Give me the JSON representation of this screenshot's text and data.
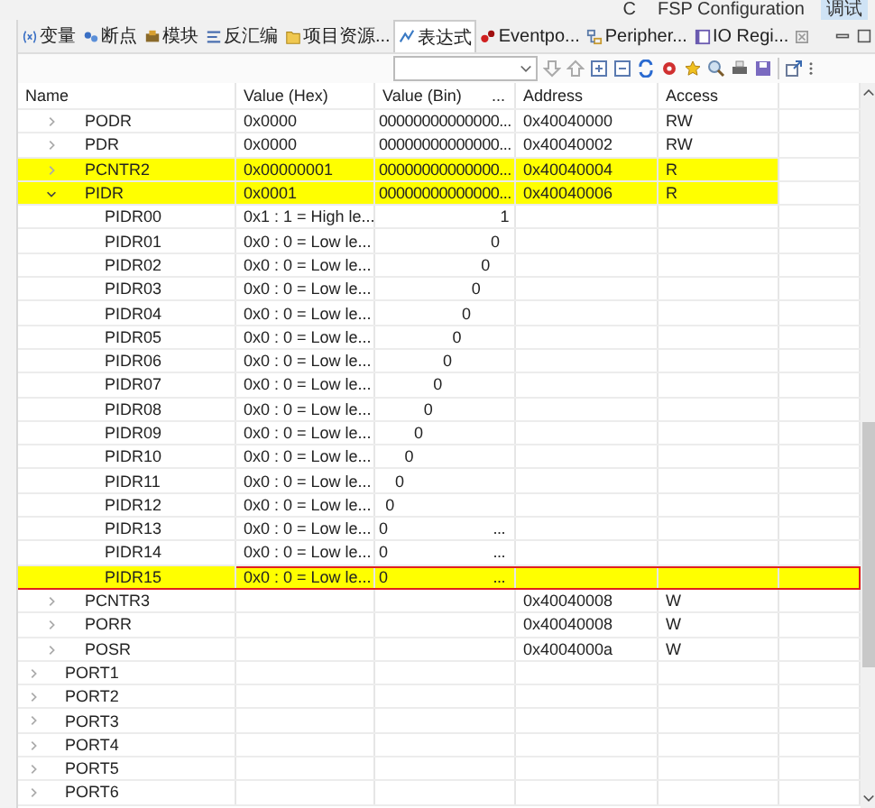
{
  "perspectives": [
    {
      "label": "C",
      "selected": false
    },
    {
      "label": "FSP Configuration",
      "selected": false
    },
    {
      "label": "调试",
      "selected": true
    }
  ],
  "tabs": [
    {
      "label": "变量",
      "kind": "variable",
      "selected": false,
      "closable": false
    },
    {
      "label": "断点",
      "kind": "breakpoint",
      "selected": false,
      "closable": false
    },
    {
      "label": "模块",
      "kind": "module",
      "selected": false,
      "closable": false
    },
    {
      "label": "反汇编",
      "kind": "disassembly",
      "selected": false,
      "closable": false
    },
    {
      "label": "项目资源...",
      "kind": "folder",
      "selected": false,
      "closable": false
    },
    {
      "label": "表达式",
      "kind": "expression",
      "selected": true,
      "closable": false
    },
    {
      "label": "Eventpo...",
      "kind": "eventpoint",
      "selected": false,
      "closable": false
    },
    {
      "label": "Peripher...",
      "kind": "peripheral",
      "selected": false,
      "closable": false
    },
    {
      "label": "IO Regi...",
      "kind": "ioreg",
      "selected": false,
      "closable": true
    }
  ],
  "table": {
    "columns": [
      {
        "label": "Name"
      },
      {
        "label": "Value (Hex)"
      },
      {
        "label": "Value (Bin)",
        "more": "..."
      },
      {
        "label": "Address"
      },
      {
        "label": "Access"
      }
    ],
    "rows": [
      {
        "children": [
          {
            "name": "PODR",
            "hex": "0x0000",
            "bin": "00000000000000...",
            "address": "0x40040000",
            "access": "RW",
            "expanded": false,
            "highlighted": false,
            "selected": false
          },
          {
            "name": "PDR",
            "hex": "0x0000",
            "bin": "00000000000000...",
            "address": "0x40040002",
            "access": "RW",
            "expanded": false,
            "highlighted": false,
            "selected": false
          },
          {
            "name": "PCNTR2",
            "hex": "0x00000001",
            "bin": "00000000000000...",
            "address": "0x40040004",
            "access": "R",
            "expanded": false,
            "highlighted": true,
            "selected": false
          },
          {
            "name": "PIDR",
            "hex": "0x0001",
            "bin": "00000000000000...",
            "address": "0x40040006",
            "access": "R",
            "expanded": true,
            "highlighted": true,
            "selected": false,
            "children": [
              {
                "name": "PIDR00",
                "hex": "0x1 : 1 = High le...",
                "bin": "1",
                "highlighted": false,
                "selected": false
              },
              {
                "name": "PIDR01",
                "hex": "0x0 : 0 = Low le...",
                "bin": "0",
                "highlighted": false,
                "selected": false
              },
              {
                "name": "PIDR02",
                "hex": "0x0 : 0 = Low le...",
                "bin": "0",
                "highlighted": false,
                "selected": false
              },
              {
                "name": "PIDR03",
                "hex": "0x0 : 0 = Low le...",
                "bin": "0",
                "highlighted": false,
                "selected": false
              },
              {
                "name": "PIDR04",
                "hex": "0x0 : 0 = Low le...",
                "bin": "0",
                "highlighted": false,
                "selected": false
              },
              {
                "name": "PIDR05",
                "hex": "0x0 : 0 = Low le...",
                "bin": "0",
                "highlighted": false,
                "selected": false
              },
              {
                "name": "PIDR06",
                "hex": "0x0 : 0 = Low le...",
                "bin": "0",
                "highlighted": false,
                "selected": false
              },
              {
                "name": "PIDR07",
                "hex": "0x0 : 0 = Low le...",
                "bin": "0",
                "highlighted": false,
                "selected": false
              },
              {
                "name": "PIDR08",
                "hex": "0x0 : 0 = Low le...",
                "bin": "0",
                "highlighted": false,
                "selected": false
              },
              {
                "name": "PIDR09",
                "hex": "0x0 : 0 = Low le...",
                "bin": "0",
                "highlighted": false,
                "selected": false
              },
              {
                "name": "PIDR10",
                "hex": "0x0 : 0 = Low le...",
                "bin": "0",
                "highlighted": false,
                "selected": false
              },
              {
                "name": "PIDR11",
                "hex": "0x0 : 0 = Low le...",
                "bin": "0",
                "highlighted": false,
                "selected": false
              },
              {
                "name": "PIDR12",
                "hex": "0x0 : 0 = Low le...",
                "bin": "0",
                "highlighted": false,
                "selected": false
              },
              {
                "name": "PIDR13",
                "hex": "0x0 : 0 = Low le...",
                "bin": "0",
                "bin_more": "...",
                "highlighted": false,
                "selected": false
              },
              {
                "name": "PIDR14",
                "hex": "0x0 : 0 = Low le...",
                "bin": "0",
                "bin_more": "...",
                "highlighted": false,
                "selected": false
              },
              {
                "name": "PIDR15",
                "hex": "0x0 : 0 = Low le...",
                "bin": "0",
                "bin_more": "...",
                "highlighted": true,
                "selected": true
              }
            ]
          },
          {
            "name": "PCNTR3",
            "address": "0x40040008",
            "access": "W",
            "expanded": false,
            "highlighted": false,
            "selected": false
          },
          {
            "name": "PORR",
            "address": "0x40040008",
            "access": "W",
            "expanded": false,
            "highlighted": false,
            "selected": false
          },
          {
            "name": "POSR",
            "address": "0x4004000a",
            "access": "W",
            "expanded": false,
            "highlighted": false,
            "selected": false
          }
        ]
      },
      {
        "name": "PORT1",
        "expanded": false,
        "highlighted": false,
        "selected": false
      },
      {
        "name": "PORT2",
        "expanded": false,
        "highlighted": false,
        "selected": false
      },
      {
        "name": "PORT3",
        "expanded": false,
        "highlighted": false,
        "selected": false
      },
      {
        "name": "PORT4",
        "expanded": false,
        "highlighted": false,
        "selected": false
      },
      {
        "name": "PORT5",
        "expanded": false,
        "highlighted": false,
        "selected": false
      },
      {
        "name": "PORT6",
        "expanded": false,
        "highlighted": false,
        "selected": false
      }
    ]
  }
}
